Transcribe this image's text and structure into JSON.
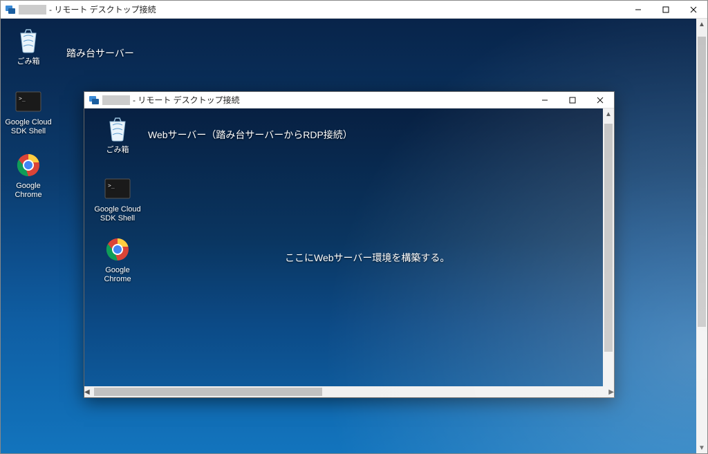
{
  "outer": {
    "title_suffix": "- リモート デスクトップ接続",
    "annotation": "踏み台サーバー",
    "icons": {
      "recycle": "ごみ箱",
      "sdk": "Google Cloud SDK Shell",
      "chrome": "Google Chrome"
    }
  },
  "inner": {
    "title_suffix": "- リモート デスクトップ接続",
    "annotation": "Webサーバー（踏み台サーバーからRDP接続）",
    "icons": {
      "recycle": "ごみ箱",
      "sdk": "Google Cloud SDK Shell",
      "chrome": "Google Chrome"
    },
    "center_message": "ここにWebサーバー環境を構築する。"
  }
}
